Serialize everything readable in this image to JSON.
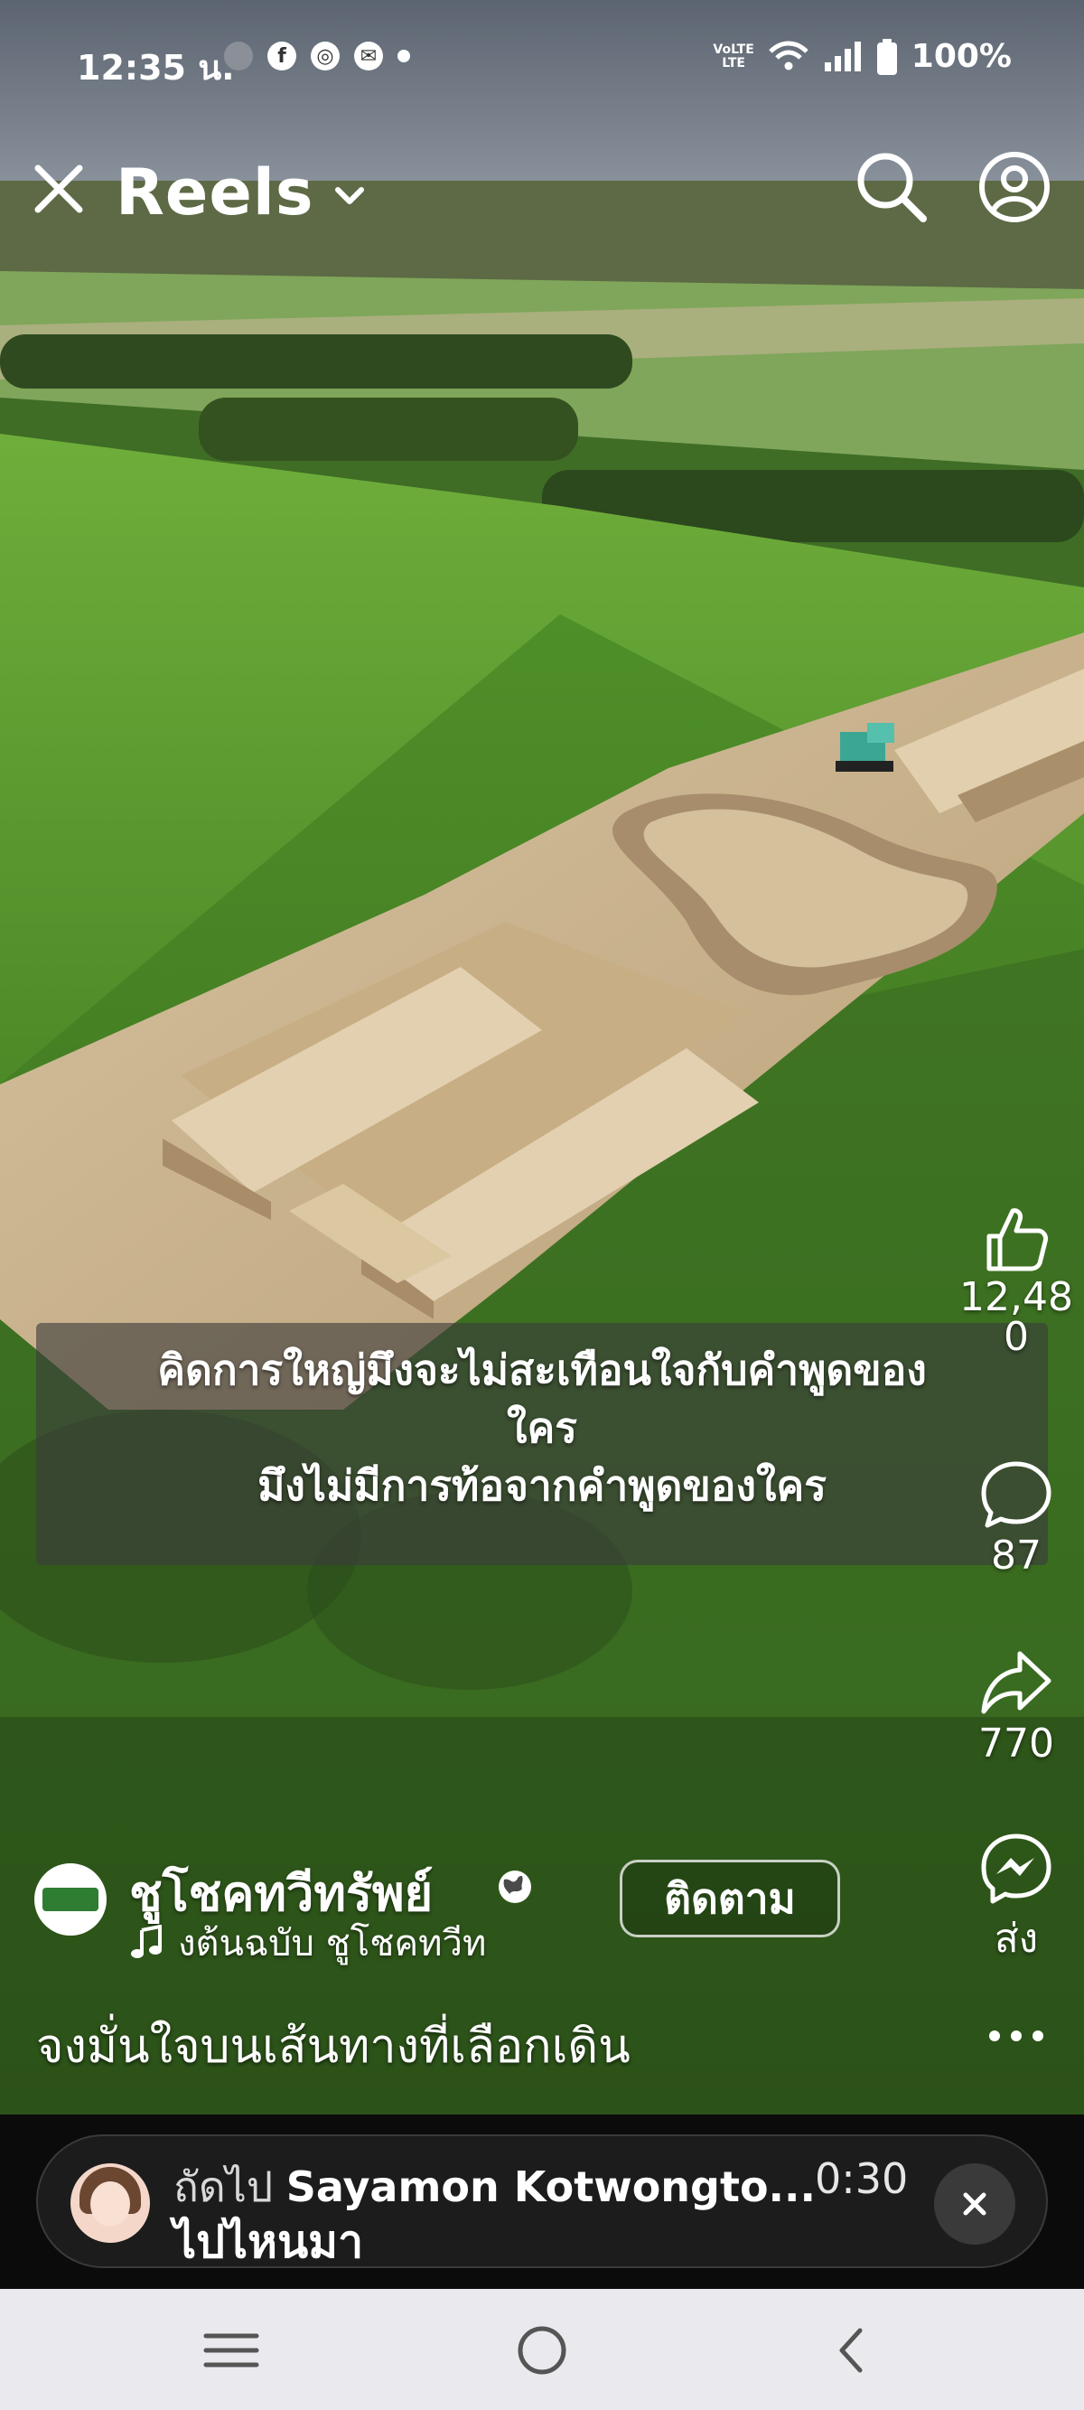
{
  "status_bar": {
    "time": "12:35 น.",
    "app_icons": [
      "grey-chat-icon",
      "facebook-icon",
      "chrome-icon",
      "messenger-cloud-icon",
      "notification-dot"
    ],
    "network_label_top": "VoLTE",
    "network_label_bottom": "LTE",
    "battery": "100%"
  },
  "top_bar": {
    "title": "Reels"
  },
  "caption": {
    "line1": "คิดการใหญ่มึงจะไม่สะเทือนใจกับคำพูดของ",
    "line2": "ใคร",
    "line3": "มึงไม่มีการท้อจากคำพูดของใคร"
  },
  "actions": {
    "likes": "12,48\n0",
    "likes_line1": "12,48",
    "likes_line2": "0",
    "comments": "87",
    "shares": "770",
    "send_label": "ส่ง"
  },
  "author": {
    "name": "ชูโชคทวีทรัพย์",
    "audio_text": "งต้นฉบับ   ชูโชคทวีท",
    "follow_label": "ติดตาม"
  },
  "post_text": "จงมั่นใจบนเส้นทางที่เลือกเดิน",
  "up_next": {
    "prefix": "ถัดไป",
    "name": "Sayamon Kotwongto...",
    "duration": "0:30",
    "title": "ไปไหนมา"
  },
  "colors": {
    "caption_bg": "#3c3c3c",
    "upnext_bg": "#1c1c1c",
    "system_nav_bg": "#e9e9ee",
    "grass": "#4f8f2c",
    "dirt": "#cbb391"
  }
}
